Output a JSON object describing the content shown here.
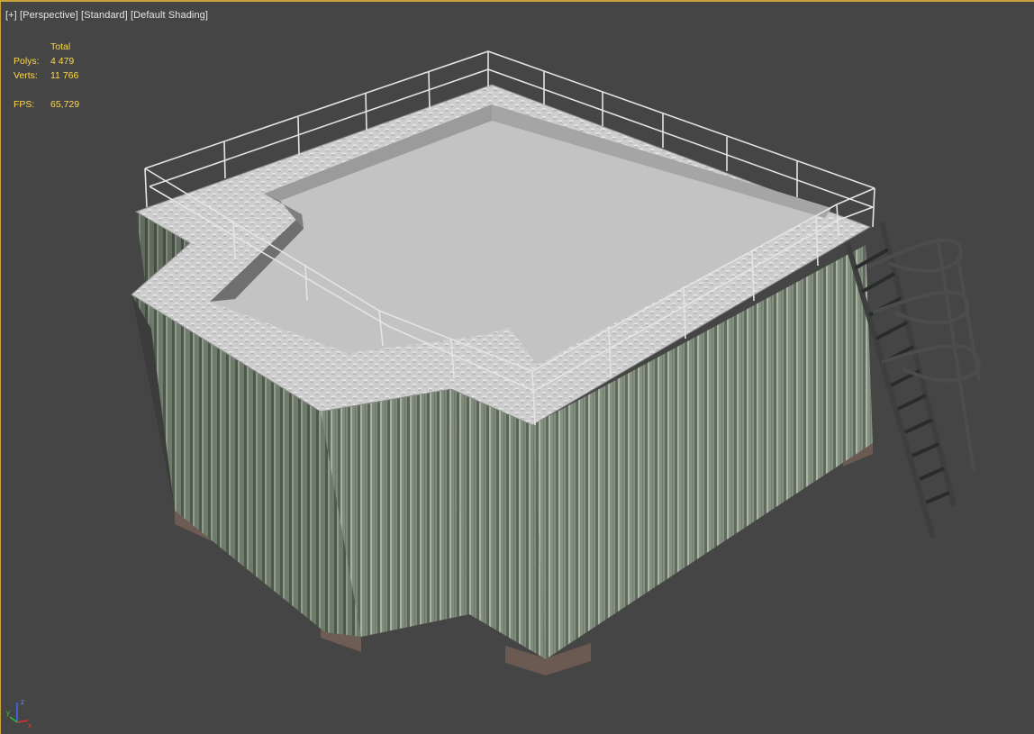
{
  "viewport": {
    "label_plus": "[+]",
    "label_view": "[Perspective]",
    "label_mode": "[Standard]",
    "label_shading": "[Default Shading]"
  },
  "stats": {
    "header": "Total",
    "polys_label": "Polys:",
    "polys_value": "4 479",
    "verts_label": "Verts:",
    "verts_value": "11 766",
    "fps_label": "FPS:",
    "fps_value": "65,729"
  },
  "gizmo": {
    "x": "x",
    "y": "y",
    "z": "z"
  },
  "colors": {
    "background": "#454545",
    "active_border": "#c8a43a",
    "stats_text": "#ffd84a",
    "wall": "#7d8a79",
    "roof": "#cfcfcf",
    "floor": "#c3c3c3"
  }
}
